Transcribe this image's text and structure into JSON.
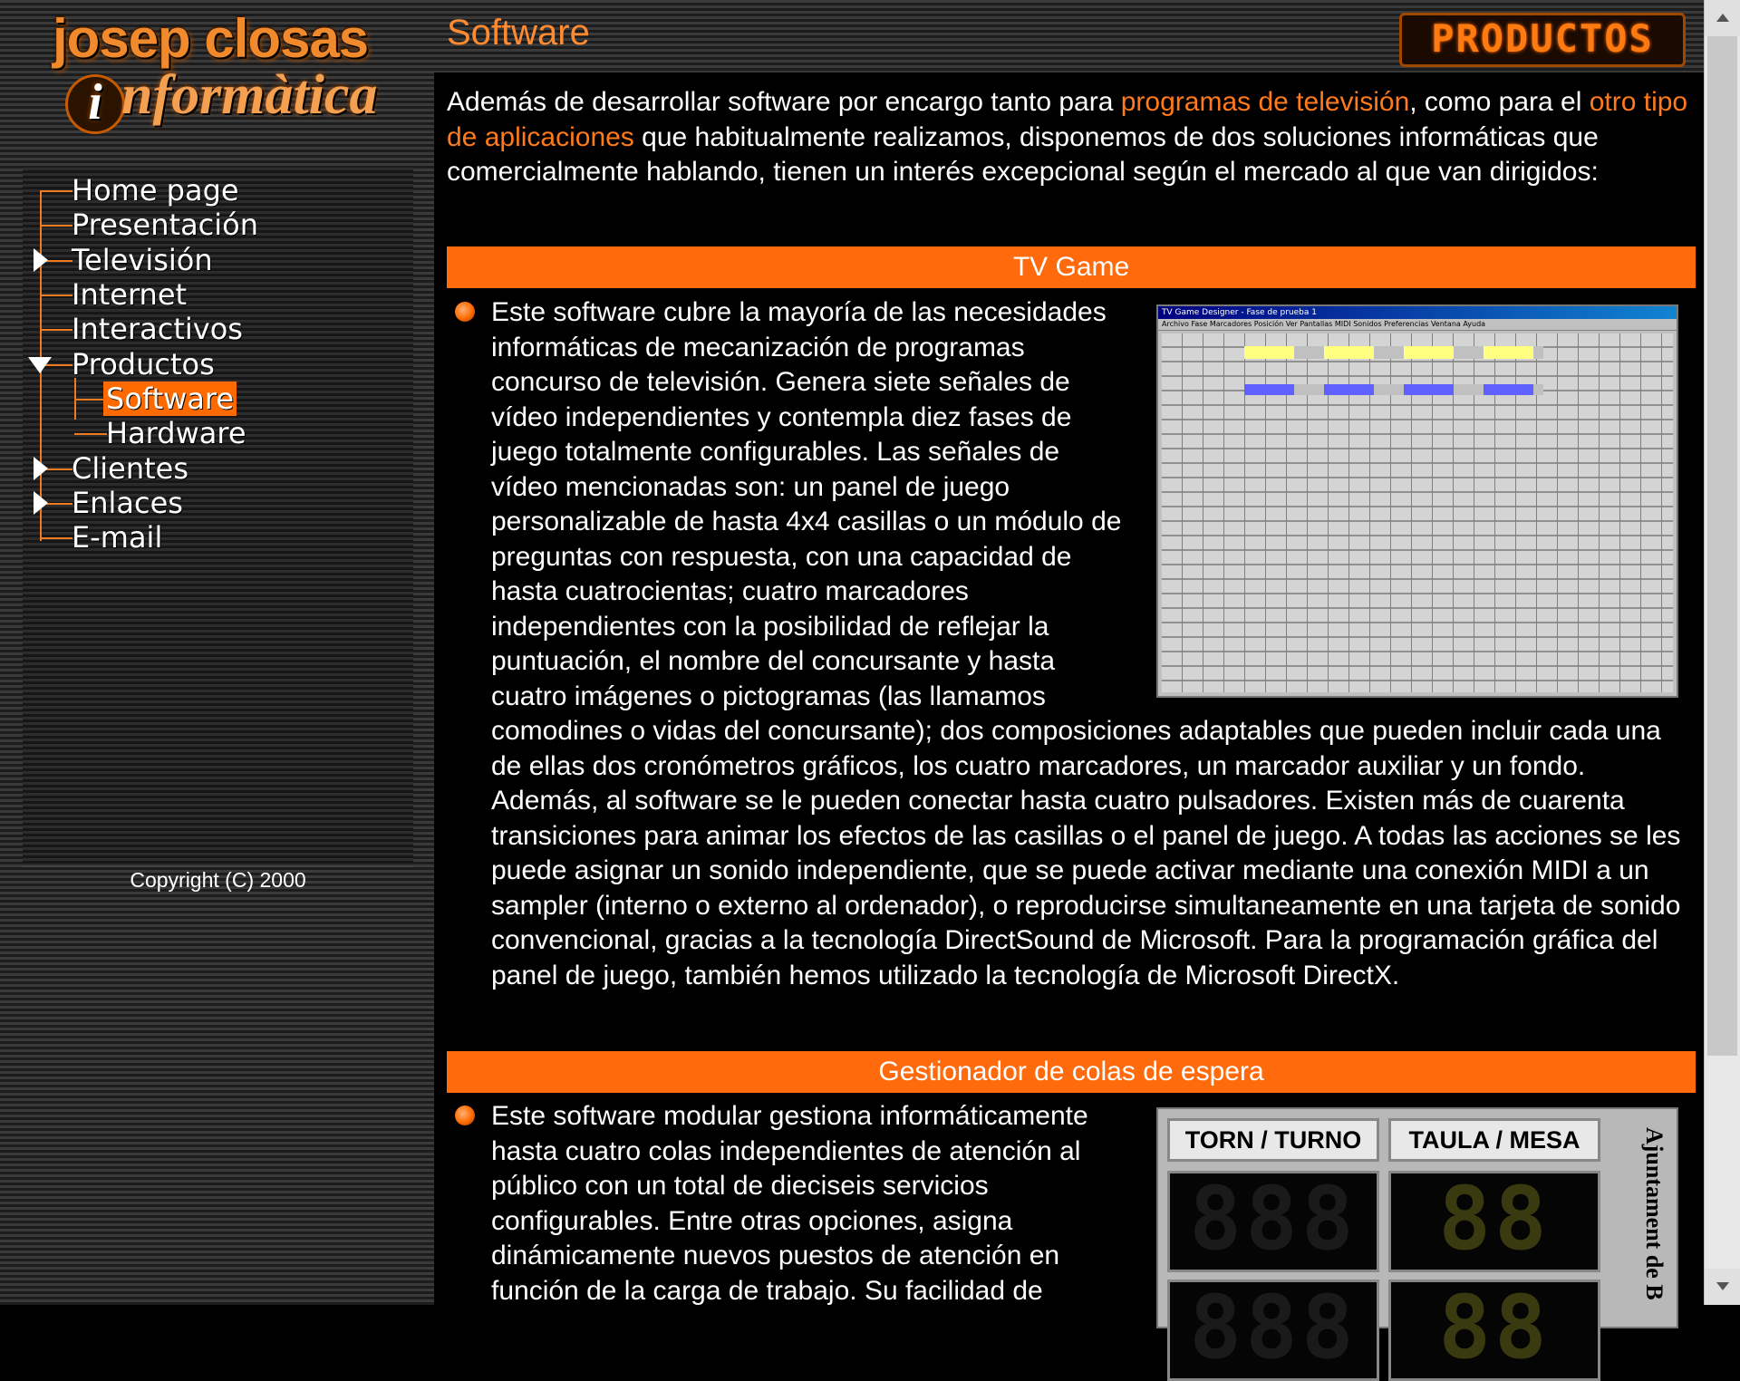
{
  "logo": {
    "line1": "josep closas",
    "line2_initial": "i",
    "line2_rest": "nformàtica"
  },
  "nav": {
    "items": [
      {
        "label": "Home page"
      },
      {
        "label": "Presentación"
      },
      {
        "label": "Televisión"
      },
      {
        "label": "Internet"
      },
      {
        "label": "Interactivos"
      },
      {
        "label": "Productos"
      },
      {
        "label": "Software"
      },
      {
        "label": "Hardware"
      },
      {
        "label": "Clientes"
      },
      {
        "label": "Enlaces"
      },
      {
        "label": "E-mail"
      }
    ],
    "active": "Software"
  },
  "copyright": "Copyright (C) 2000",
  "header": {
    "title": "Software",
    "section_badge": "PRODUCTOS"
  },
  "intro": {
    "part1": "Además de desarrollar software por encargo tanto para ",
    "link1": "programas de televisión",
    "part2": ", como para el ",
    "link2": "otro tipo de aplicaciones",
    "part3": " que habitualmente realizamos, disponemos de dos soluciones informáticas que comercialmente hablando, tienen un interés excepcional según el mercado al que van dirigidos:"
  },
  "sections": [
    {
      "title": "TV Game",
      "text": "Este software cubre la mayoría de las necesidades informáticas de mecanización de programas concurso de televisión. Genera siete señales de vídeo independientes y contempla diez fases de juego totalmente configurables. Las señales de vídeo mencionadas son: un panel de juego personalizable de hasta 4x4 casillas o un módulo de preguntas con respuesta, con una capacidad de hasta cuatrocientas; cuatro marcadores independientes con la posibilidad de reflejar la puntuación, el nombre del concursante y hasta cuatro imágenes o pictogramas (las llamamos comodines o vidas del concursante); dos composiciones adaptables que pueden incluir cada una de ellas dos cronómetros gráficos, los cuatro marcadores, un marcador auxiliar y un fondo. Además, al software se le pueden conectar hasta cuatro pulsadores. Existen más de cuarenta transiciones para animar los efectos de las casillas o el panel de juego. A todas las acciones se les puede asignar un sonido independiente, que se puede activar mediante una conexión MIDI a un sampler (interno o externo al ordenador), o reproducirse simultaneamente en una tarjeta de sonido convencional, gracias a la tecnología DirectSound de Microsoft. Para la programación gráfica del panel de juego, también hemos utilizado la tecnología de Microsoft DirectX.",
      "screenshot": {
        "title": "TV Game Designer - Fase de prueba 1",
        "menu": "Archivo  Fase  Marcadores  Posición  Ver  Pantallas MIDI  Sonidos  Preferencias  Ventana  Ayuda"
      }
    },
    {
      "title": "Gestionador de colas de espera",
      "text": "Este software modular gestiona informáticamente hasta cuatro colas independientes de atención al público con un total de dieciseis servicios configurables. Entre otras opciones, asigna dinámicamente nuevos puestos de atención en función de la carga de trabajo. Su facilidad de",
      "screenshot": {
        "label_turn": "TORN / TURNO",
        "label_table": "TAULA / MESA",
        "side_text": "Ajuntament de B"
      }
    }
  ]
}
